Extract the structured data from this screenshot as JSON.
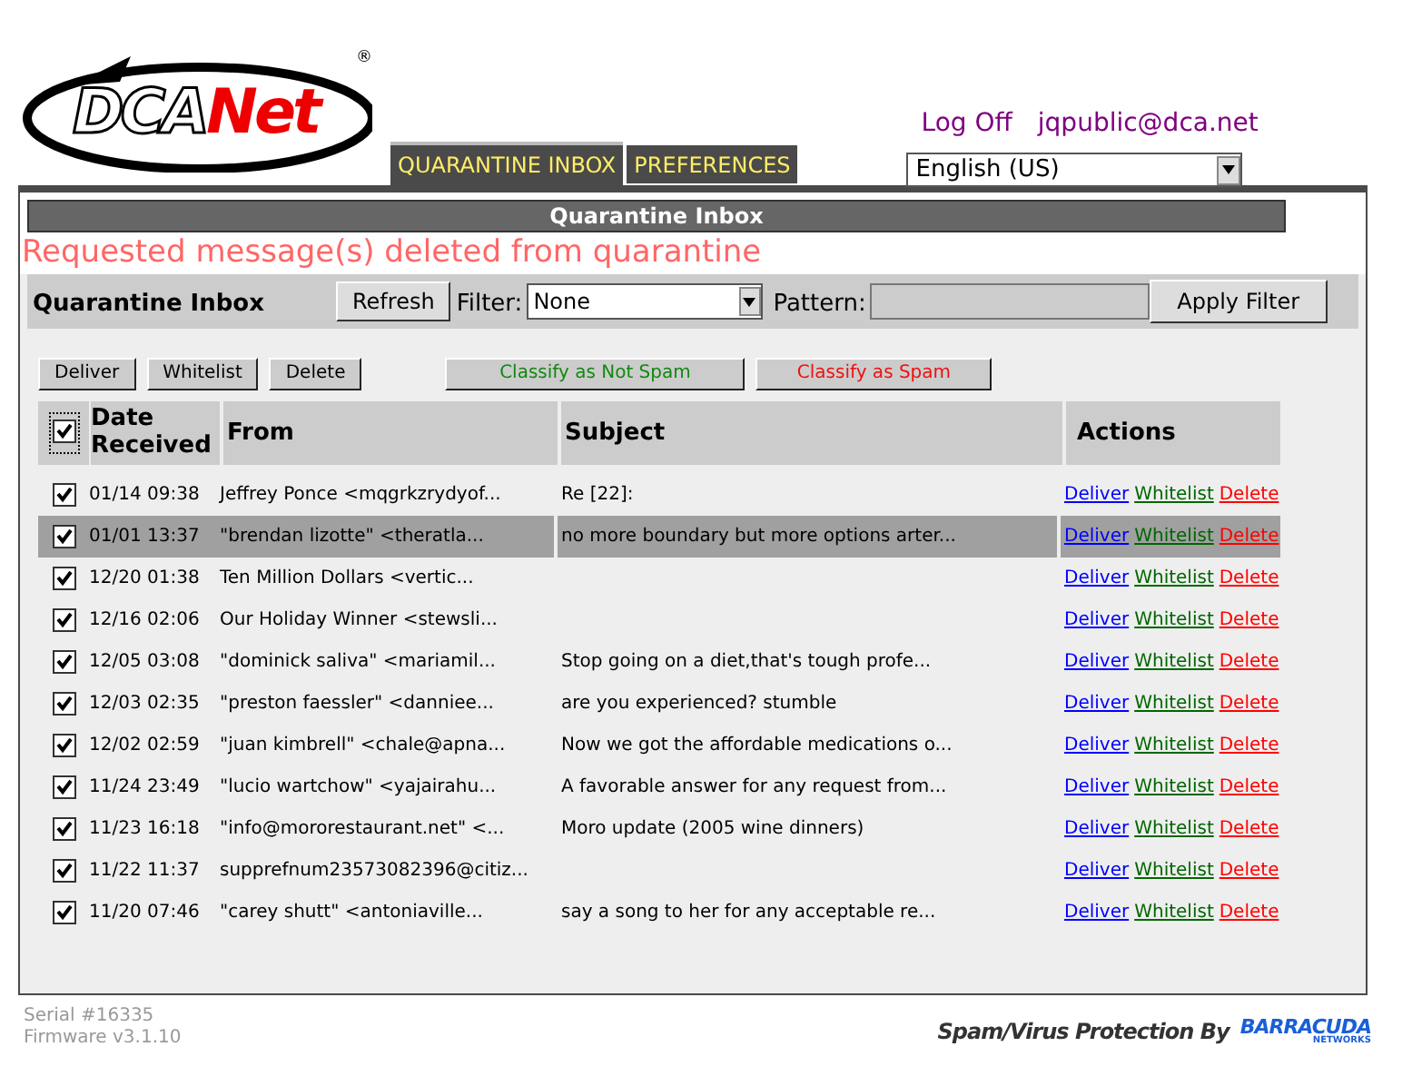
{
  "logo": {
    "text_1": "DCA",
    "text_2": "Net",
    "mark": "®"
  },
  "tabs": [
    {
      "label": "QUARANTINE INBOX",
      "selected": true
    },
    {
      "label": "PREFERENCES",
      "selected": false
    }
  ],
  "user_links": [
    "Log Off",
    "jqpublic@dca.net"
  ],
  "language": {
    "value": "English (US)"
  },
  "panel_title": "Quarantine Inbox",
  "message": "Requested message(s) deleted from quarantine",
  "filter_bar": {
    "title": "Quarantine Inbox",
    "refresh": "Refresh",
    "filter_label": "Filter:",
    "filter_value": "None",
    "pattern_label": "Pattern:",
    "apply": "Apply Filter"
  },
  "actions": [
    {
      "label": "Deliver",
      "kind": "plain"
    },
    {
      "label": "Whitelist",
      "kind": "plain"
    },
    {
      "label": "Delete",
      "kind": "plain"
    },
    {
      "label": "Classify as Not Spam",
      "kind": "ham"
    },
    {
      "label": "Classify as Spam",
      "kind": "spam"
    }
  ],
  "table": {
    "select_all_checked": true,
    "columns": [
      "Date Received",
      "From",
      "Subject",
      "Actions"
    ],
    "rows": [
      {
        "checked": true,
        "selected": false,
        "date": "01/14 09:38",
        "from": "Jeffrey Ponce <mqgrkzrydyof...",
        "subject": "Re [22]:",
        "links": [
          "Deliver",
          "Whitelist",
          "Delete"
        ]
      },
      {
        "checked": true,
        "selected": true,
        "date": "01/01 13:37",
        "from": "\"brendan lizotte\" <theratla...",
        "subject": "no more boundary but more options arter...",
        "links": [
          "Deliver",
          "Whitelist",
          "Delete"
        ]
      },
      {
        "checked": true,
        "selected": false,
        "date": "12/20 01:38",
        "from": "Ten Million Dollars <vertic...",
        "subject": "",
        "links": [
          "Deliver",
          "Whitelist",
          "Delete"
        ]
      },
      {
        "checked": true,
        "selected": false,
        "date": "12/16 02:06",
        "from": "Our Holiday Winner <stewsli...",
        "subject": "",
        "links": [
          "Deliver",
          "Whitelist",
          "Delete"
        ]
      },
      {
        "checked": true,
        "selected": false,
        "date": "12/05 03:08",
        "from": "\"dominick saliva\" <mariamil...",
        "subject": "Stop going on a diet,that's tough profe...",
        "links": [
          "Deliver",
          "Whitelist",
          "Delete"
        ]
      },
      {
        "checked": true,
        "selected": false,
        "date": "12/03 02:35",
        "from": "\"preston faessler\" <danniee...",
        "subject": "are you experienced? stumble",
        "links": [
          "Deliver",
          "Whitelist",
          "Delete"
        ]
      },
      {
        "checked": true,
        "selected": false,
        "date": "12/02 02:59",
        "from": "\"juan kimbrell\" <chale@apna...",
        "subject": "Now we got the affordable medications o...",
        "links": [
          "Deliver",
          "Whitelist",
          "Delete"
        ]
      },
      {
        "checked": true,
        "selected": false,
        "date": "11/24 23:49",
        "from": "\"lucio wartchow\" <yajairahu...",
        "subject": "A favorable answer for any request from...",
        "links": [
          "Deliver",
          "Whitelist",
          "Delete"
        ]
      },
      {
        "checked": true,
        "selected": false,
        "date": "11/23 16:18",
        "from": "\"info@mororestaurant.net\" <...",
        "subject": "Moro update (2005 wine dinners)",
        "links": [
          "Deliver",
          "Whitelist",
          "Delete"
        ]
      },
      {
        "checked": true,
        "selected": false,
        "date": "11/22 11:37",
        "from": "supprefnum23573082396@citiz...",
        "subject": "",
        "links": [
          "Deliver",
          "Whitelist",
          "Delete"
        ]
      },
      {
        "checked": true,
        "selected": false,
        "date": "11/20 07:46",
        "from": "\"carey shutt\" <antoniaville...",
        "subject": "say a song to her for any acceptable re...",
        "links": [
          "Deliver",
          "Whitelist",
          "Delete"
        ]
      }
    ]
  },
  "footer": {
    "serial": "Serial #16335",
    "firmware": "Firmware v3.1.10",
    "protection": "Spam/Virus Protection By",
    "brand": "BARRACUDA",
    "brand_sub": "NETWORKS"
  }
}
